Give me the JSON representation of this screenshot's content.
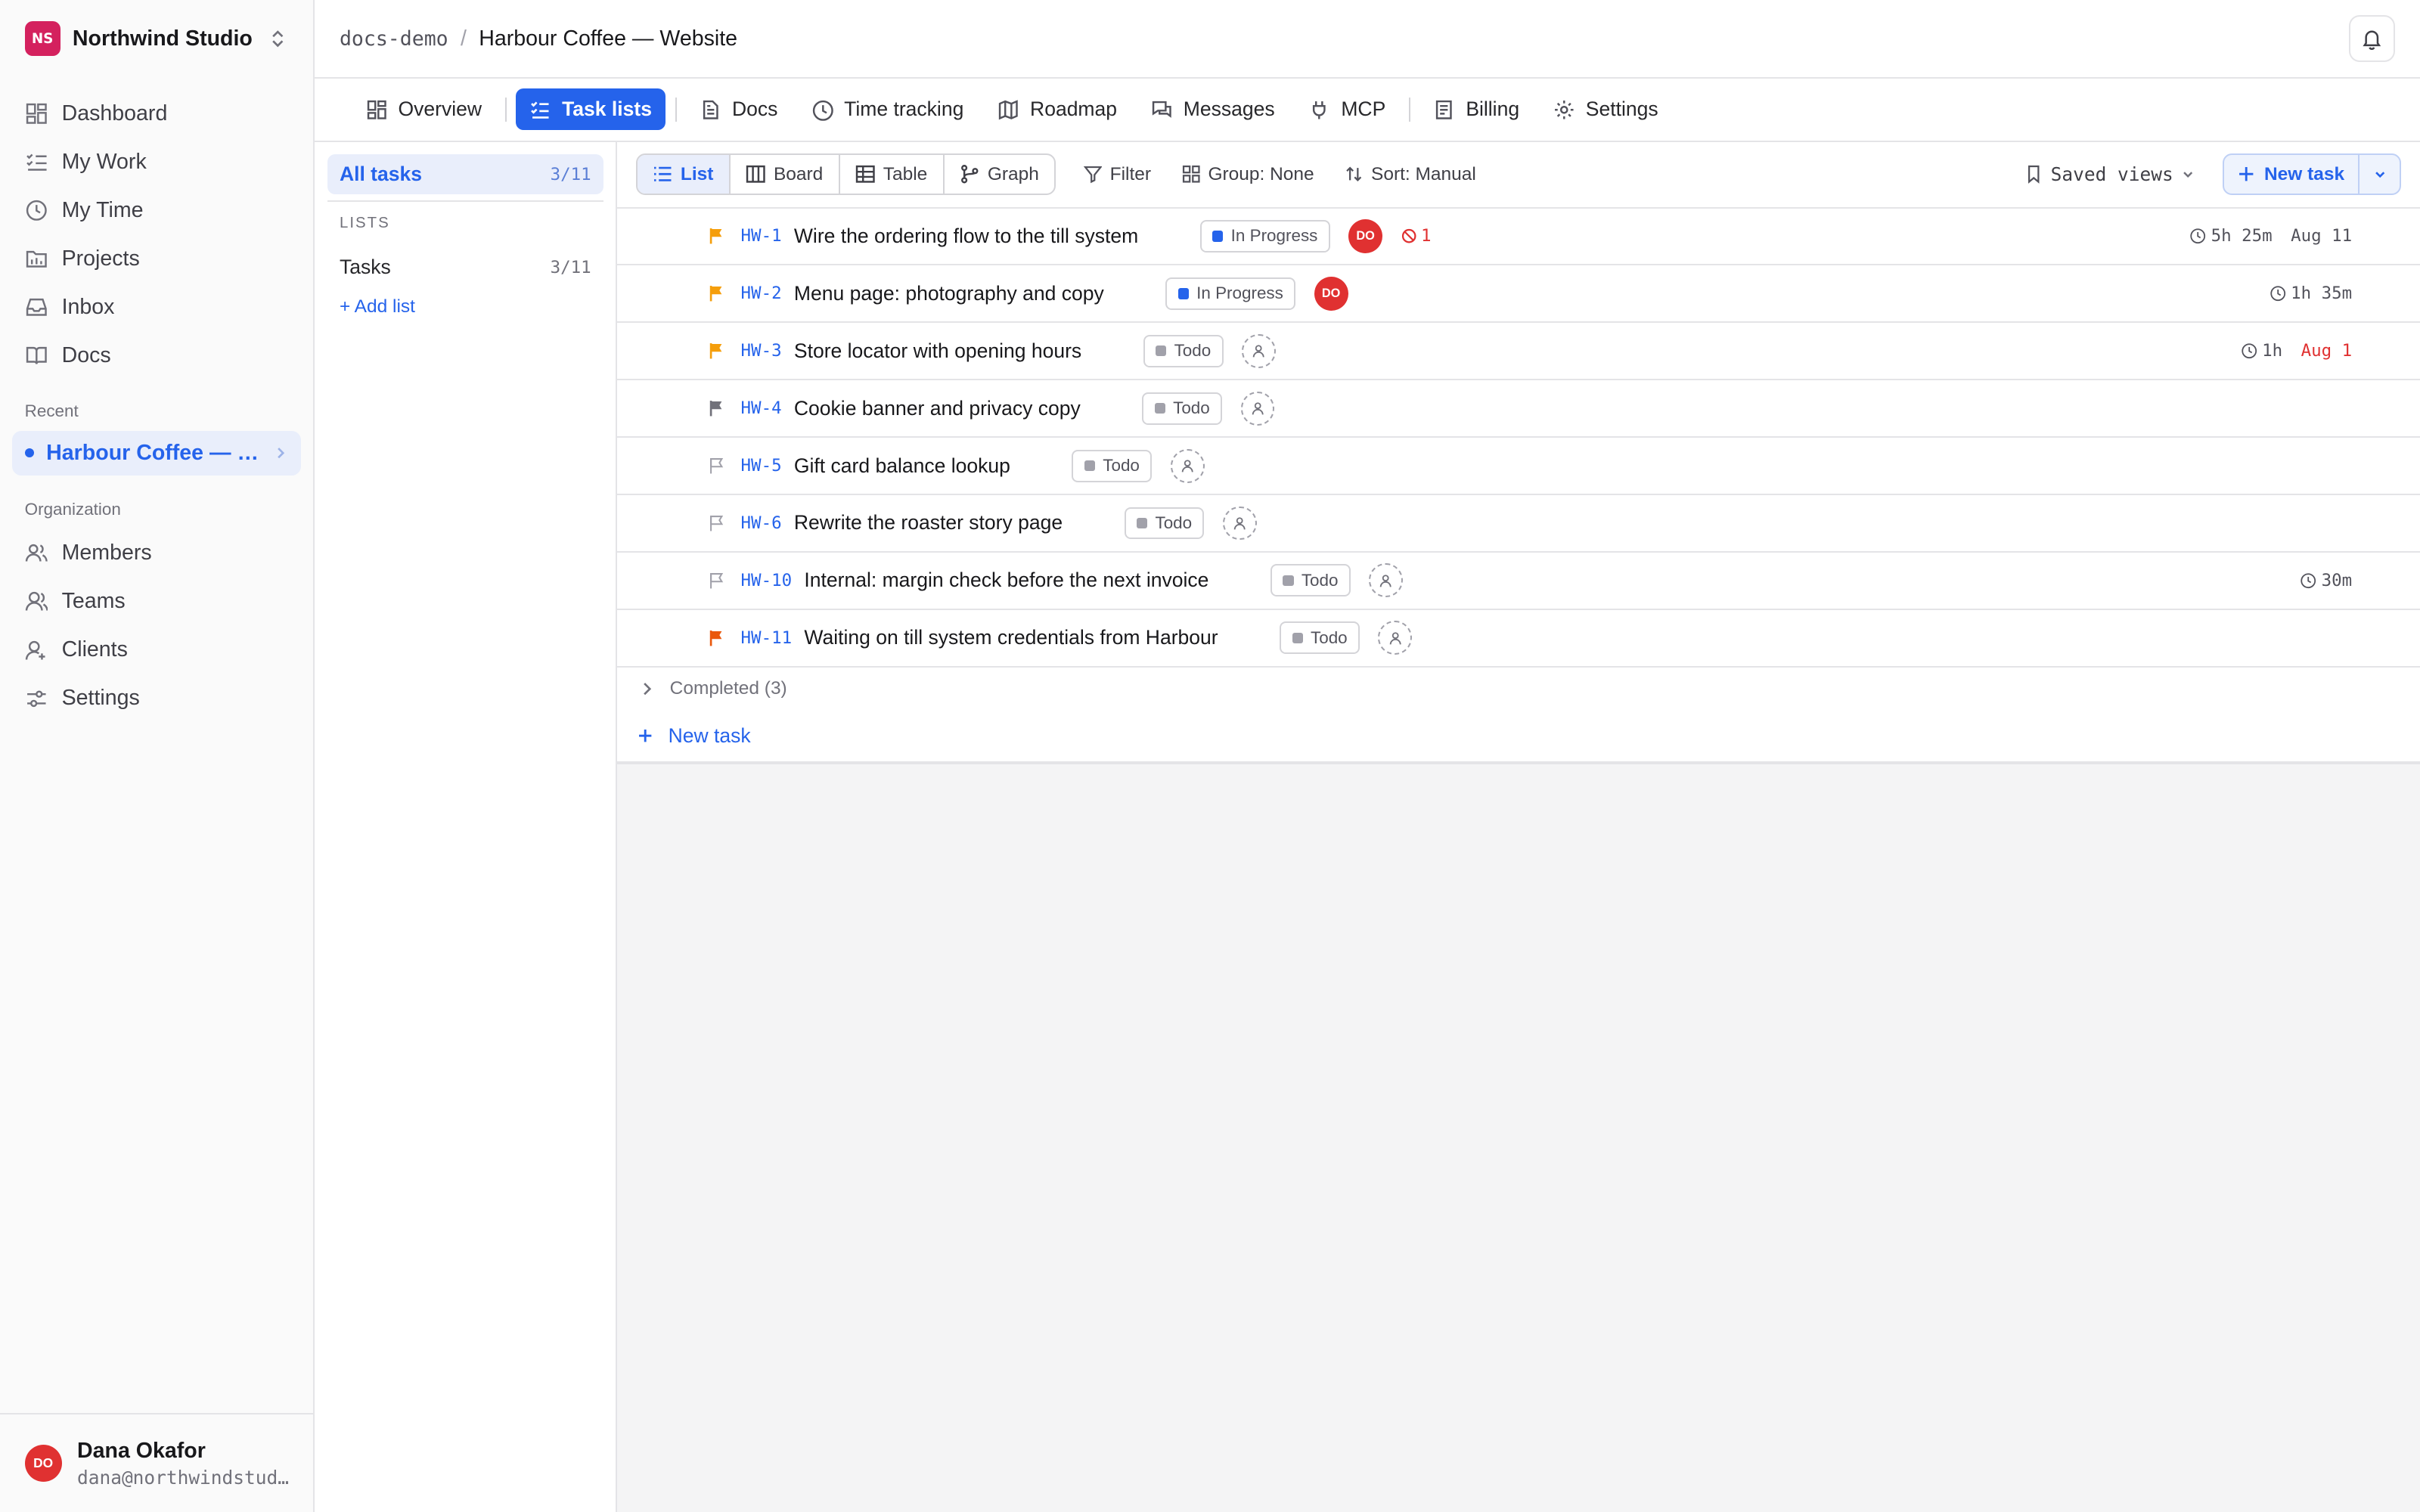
{
  "workspace": {
    "initials": "NS",
    "name": "Northwind Studio",
    "color": "#d4215e"
  },
  "nav": [
    {
      "label": "Dashboard",
      "icon": "dashboard-icon"
    },
    {
      "label": "My Work",
      "icon": "list-check-icon"
    },
    {
      "label": "My Time",
      "icon": "clock-icon"
    },
    {
      "label": "Projects",
      "icon": "folder-icon"
    },
    {
      "label": "Inbox",
      "icon": "inbox-icon"
    },
    {
      "label": "Docs",
      "icon": "book-icon"
    }
  ],
  "recent": {
    "label": "Recent",
    "items": [
      {
        "label": "Harbour Coffee — Website"
      }
    ]
  },
  "organization": {
    "label": "Organization",
    "items": [
      {
        "label": "Members",
        "icon": "users-icon"
      },
      {
        "label": "Teams",
        "icon": "teams-icon"
      },
      {
        "label": "Clients",
        "icon": "client-icon"
      },
      {
        "label": "Settings",
        "icon": "sliders-icon"
      }
    ]
  },
  "user": {
    "initials": "DO",
    "name": "Dana Okafor",
    "email": "dana@northwindstudio.com"
  },
  "breadcrumb": {
    "workspace": "docs-demo",
    "separator": "/",
    "project": "Harbour Coffee — Website"
  },
  "tabs": [
    {
      "label": "Overview",
      "icon": "grid-icon",
      "active": false
    },
    {
      "label": "Task lists",
      "icon": "checklist-icon",
      "active": true
    },
    {
      "label": "Docs",
      "icon": "document-icon",
      "active": false
    },
    {
      "label": "Time tracking",
      "icon": "clock-icon",
      "active": false
    },
    {
      "label": "Roadmap",
      "icon": "map-icon",
      "active": false
    },
    {
      "label": "Messages",
      "icon": "messages-icon",
      "active": false
    },
    {
      "label": "MCP",
      "icon": "plug-icon",
      "active": false
    },
    {
      "label": "Billing",
      "icon": "receipt-icon",
      "active": false
    },
    {
      "label": "Settings",
      "icon": "gear-icon",
      "active": false
    }
  ],
  "lists_panel": {
    "all_tasks": {
      "label": "All tasks",
      "count": "3/11"
    },
    "lists_label": "LISTS",
    "lists": [
      {
        "label": "Tasks",
        "count": "3/11"
      }
    ],
    "add_list": "+ Add list"
  },
  "toolbar": {
    "views": [
      {
        "label": "List",
        "icon": "list-icon",
        "active": true
      },
      {
        "label": "Board",
        "icon": "board-icon",
        "active": false
      },
      {
        "label": "Table",
        "icon": "table-icon",
        "active": false
      },
      {
        "label": "Graph",
        "icon": "graph-icon",
        "active": false
      }
    ],
    "filter": "Filter",
    "group": "Group: None",
    "sort": "Sort: Manual",
    "saved_views": "Saved views",
    "new_task": "New task"
  },
  "colors": {
    "accent": "#2563eb",
    "flag_orange": "#f59e0b",
    "flag_gray": "#71717a",
    "in_progress": "#2563eb",
    "todo": "#a1a1aa",
    "danger": "#e03131"
  },
  "tasks": [
    {
      "id": "HW-1",
      "title": "Wire the ordering flow to the till system",
      "status": "In Progress",
      "status_color": "#2563eb",
      "priority": "high",
      "assignee": "DO",
      "blocked": "1",
      "time": "5h 25m",
      "due": "Aug 11",
      "overdue": false
    },
    {
      "id": "HW-2",
      "title": "Menu page: photography and copy",
      "status": "In Progress",
      "status_color": "#2563eb",
      "priority": "high",
      "assignee": "DO",
      "blocked": null,
      "time": "1h 35m",
      "due": null,
      "overdue": false
    },
    {
      "id": "HW-3",
      "title": "Store locator with opening hours",
      "status": "Todo",
      "status_color": "#a1a1aa",
      "priority": "high",
      "assignee": null,
      "blocked": null,
      "time": "1h",
      "due": "Aug 1",
      "overdue": true
    },
    {
      "id": "HW-4",
      "title": "Cookie banner and privacy copy",
      "status": "Todo",
      "status_color": "#a1a1aa",
      "priority": "medium",
      "assignee": null,
      "blocked": null,
      "time": null,
      "due": null,
      "overdue": false
    },
    {
      "id": "HW-5",
      "title": "Gift card balance lookup",
      "status": "Todo",
      "status_color": "#a1a1aa",
      "priority": "none",
      "assignee": null,
      "blocked": null,
      "time": null,
      "due": null,
      "overdue": false
    },
    {
      "id": "HW-6",
      "title": "Rewrite the roaster story page",
      "status": "Todo",
      "status_color": "#a1a1aa",
      "priority": "none",
      "assignee": null,
      "blocked": null,
      "time": null,
      "due": null,
      "overdue": false
    },
    {
      "id": "HW-10",
      "title": "Internal: margin check before the next invoice",
      "status": "Todo",
      "status_color": "#a1a1aa",
      "priority": "none",
      "assignee": null,
      "blocked": null,
      "time": "30m",
      "due": null,
      "overdue": false
    },
    {
      "id": "HW-11",
      "title": "Waiting on till system credentials from Harbour",
      "status": "Todo",
      "status_color": "#a1a1aa",
      "priority": "urgent",
      "assignee": null,
      "blocked": null,
      "time": null,
      "due": null,
      "overdue": false
    }
  ],
  "completed": {
    "label": "Completed (3)"
  },
  "new_task_row": {
    "label": "New task"
  }
}
